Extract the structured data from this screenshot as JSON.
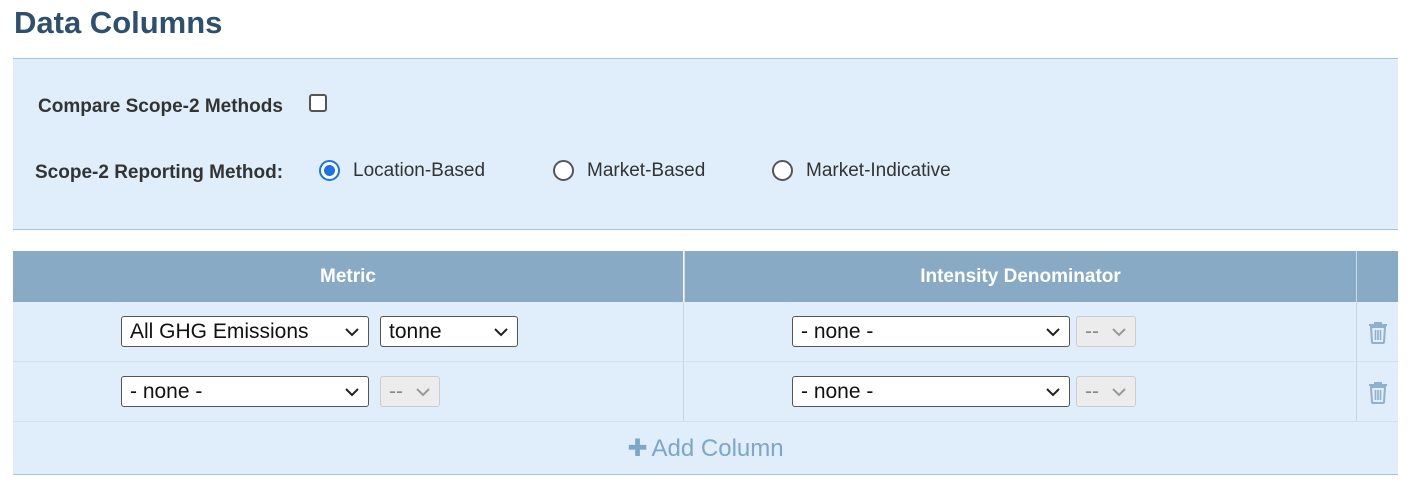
{
  "page": {
    "title": "Data Columns"
  },
  "options": {
    "compare_label": "Compare Scope-2 Methods",
    "compare_checked": false,
    "method_label": "Scope-2 Reporting Method:",
    "methods": [
      {
        "label": "Location-Based",
        "selected": true
      },
      {
        "label": "Market-Based",
        "selected": false
      },
      {
        "label": "Market-Indicative",
        "selected": false
      }
    ]
  },
  "grid": {
    "headers": {
      "metric": "Metric",
      "denominator": "Intensity Denominator"
    },
    "rows": [
      {
        "metric": "All GHG Emissions",
        "unit": "tonne",
        "unit_enabled": true,
        "denominator": "- none -",
        "denominator_unit": "--"
      },
      {
        "metric": "- none -",
        "unit": "--",
        "unit_enabled": false,
        "denominator": "- none -",
        "denominator_unit": "--"
      }
    ],
    "add_label": "Add Column"
  },
  "colors": {
    "header_bg": "#89aac4",
    "panel_bg": "#dfeefa",
    "title": "#2f4f6f",
    "radio_selected": "#1a73e8",
    "add_button": "#7ea6c6"
  }
}
